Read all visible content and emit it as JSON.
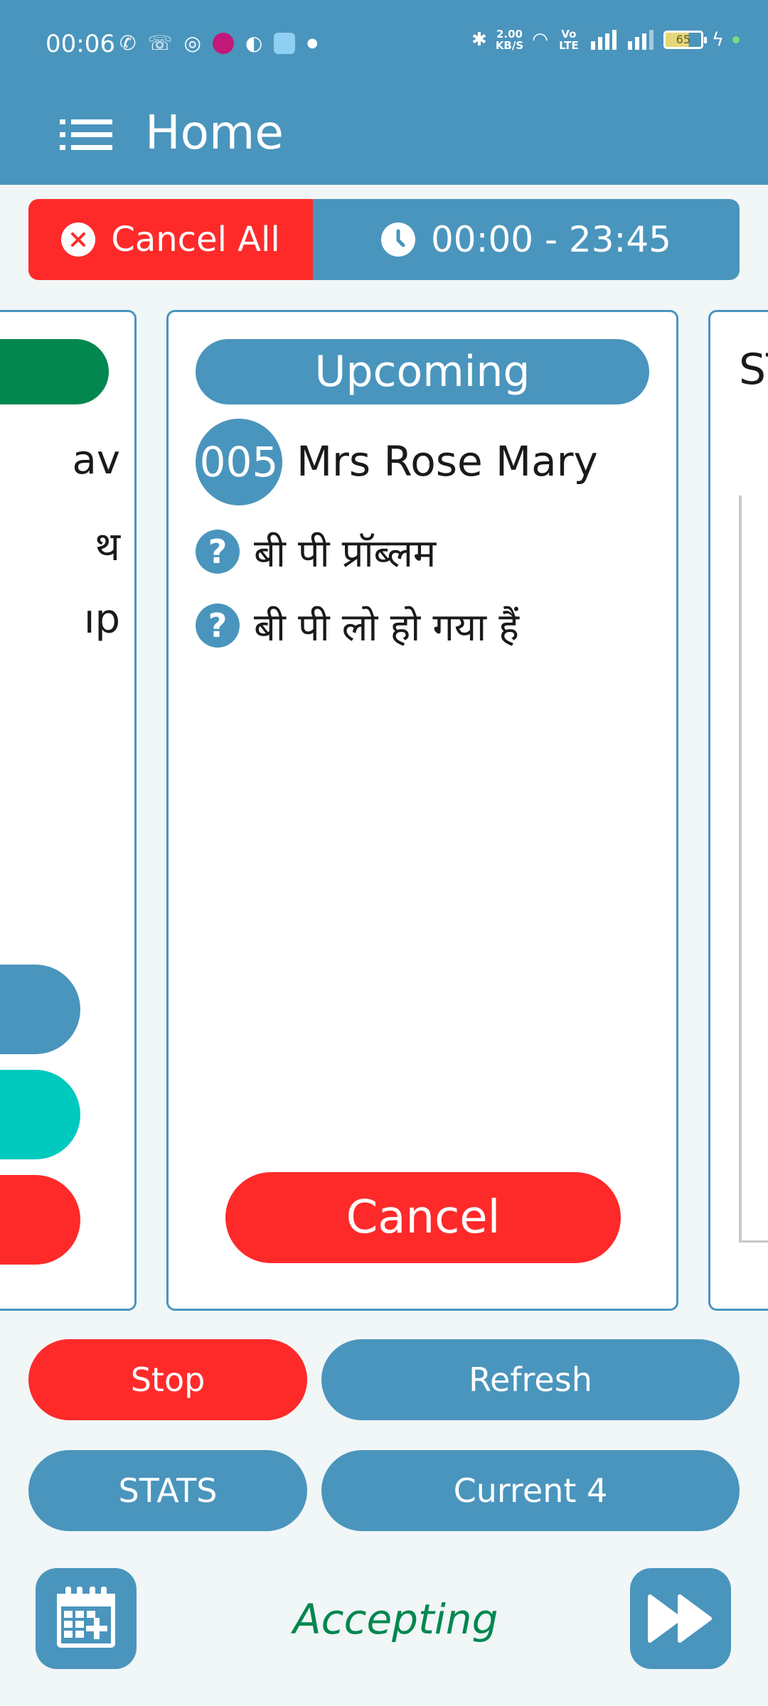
{
  "status_bar": {
    "time": "00:06",
    "left_icons": [
      "phone-icon",
      "missed-call-icon",
      "instagram-icon",
      "app-icon",
      "chrome-icon",
      "cloud-icon",
      "more-dot-icon"
    ],
    "speed_value": "2.00",
    "speed_unit": "KB/S",
    "network_label": "Vo LTE",
    "battery": "65"
  },
  "app_bar": {
    "title": "Home"
  },
  "top_bar": {
    "cancel_all_label": "Cancel All",
    "time_range": "00:00 - 23:45"
  },
  "left_card": {
    "line1": "av",
    "line2": "थ",
    "line3": "ıp",
    "colors": [
      "#01874f",
      "#4a95bd",
      "#00c9bd",
      "#fe2a2a"
    ]
  },
  "main_card": {
    "status": "Upcoming",
    "token": "005",
    "patient_name": "Mrs Rose Mary",
    "symptoms": [
      "बी पी प्रॉब्लम",
      "बी पी लो हो गया हैं"
    ],
    "cancel_label": "Cancel"
  },
  "right_card": {
    "text": "ST"
  },
  "actions": {
    "stop_label": "Stop",
    "refresh_label": "Refresh",
    "stats_label": "STATS",
    "current_label": "Current  4"
  },
  "footer": {
    "calendar_icon": "calendar-add-icon",
    "status_text": "Accepting",
    "next_icon": "fast-forward-icon"
  },
  "colors": {
    "primary": "#4a95bd",
    "danger": "#fe2a2a",
    "success": "#01874f",
    "teal": "#00c9bd"
  }
}
